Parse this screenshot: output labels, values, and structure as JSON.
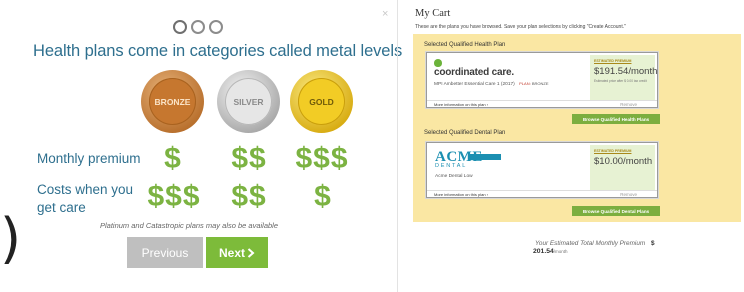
{
  "metal_levels": {
    "close_symbol": "×",
    "title": "Health plans come in categories called metal levels",
    "medals": [
      {
        "label": "BRONZE",
        "color": "#c6772f"
      },
      {
        "label": "SILVER",
        "color": "#e6e6e6"
      },
      {
        "label": "GOLD",
        "color": "#f2cc25"
      }
    ],
    "rows": [
      {
        "label": "Monthly premium",
        "values": [
          "$",
          "$$",
          "$$$"
        ]
      },
      {
        "label_line1": "Costs when you",
        "label_line2": "get care",
        "values": [
          "$$$",
          "$$",
          "$"
        ]
      }
    ],
    "footnote": "Platinum and Catastropic plans may also be available",
    "previous_label": "Previous",
    "next_label": "Next",
    "next_icon": "chevron-right",
    "paren": ")",
    "accent_color": "#7cb342",
    "title_color": "#2e6f8e"
  },
  "cart": {
    "title": "My Cart",
    "description": "These are the plans you have browsed. Save your plan selections by clicking \"Create Account.\"",
    "health": {
      "section_label": "Selected Qualified Health Plan",
      "logo_text": "coordinated care.",
      "plan_name": "MPI Ambetter Essential Care 1 (2017)",
      "plan_label": "PLAN:",
      "tier": "BRONZE",
      "estimated_label": "ESTIMATED PREMIUM",
      "price": "$191.54/month",
      "note": "Estimated price after $ 0.00 tax credit",
      "more_info": "More information on this plan ›",
      "remove_label": "Remove",
      "browse_label": "Browse Qualified Health Plans"
    },
    "dental": {
      "section_label": "Selected Qualified Dental Plan",
      "logo_text": "ACME",
      "logo_sub": "DENTAL",
      "plan_name": "Acme Dental Low",
      "estimated_label": "ESTIMATED PREMIUM",
      "price": "$10.00/month",
      "more_info": "More information on this plan ›",
      "remove_label": "Remove",
      "browse_label": "Browse Qualified Dental Plans"
    },
    "total_label": "Your Estimated Total Monthly Premium",
    "total_currency": "$",
    "total_amount": "201.54",
    "total_unit": "/month",
    "box_color": "#fae7a3"
  }
}
